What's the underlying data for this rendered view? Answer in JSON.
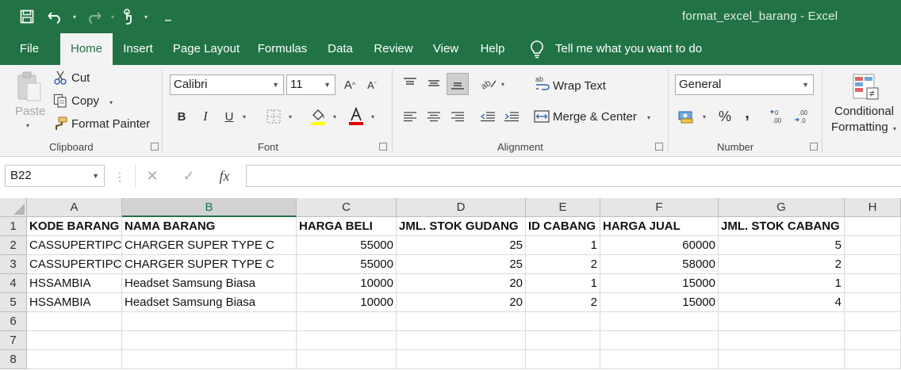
{
  "window": {
    "title": "format_excel_barang  -  Excel"
  },
  "qat": {
    "icons": [
      "save-icon",
      "undo-icon",
      "redo-icon",
      "touch-mode-icon",
      "customize-qat-icon"
    ]
  },
  "tabs": [
    {
      "label": "File"
    },
    {
      "label": "Home"
    },
    {
      "label": "Insert"
    },
    {
      "label": "Page Layout"
    },
    {
      "label": "Formulas"
    },
    {
      "label": "Data"
    },
    {
      "label": "Review"
    },
    {
      "label": "View"
    },
    {
      "label": "Help"
    }
  ],
  "tell_me": "Tell me what you want to do",
  "ribbon": {
    "clipboard": {
      "label": "Clipboard",
      "paste": "Paste",
      "cut": "Cut",
      "copy": "Copy",
      "format_painter": "Format Painter"
    },
    "font": {
      "label": "Font",
      "font_name": "Calibri",
      "font_size": "11",
      "bold": "B",
      "italic": "I",
      "underline": "U",
      "fill_color": "#ffff00",
      "font_color": "#e00000"
    },
    "alignment": {
      "label": "Alignment",
      "wrap_text": "Wrap Text",
      "merge_center": "Merge & Center"
    },
    "number": {
      "label": "Number",
      "format": "General",
      "percent": "%",
      "comma": ","
    },
    "styles": {
      "conditional_formatting_line1": "Conditional",
      "conditional_formatting_line2": "Formatting"
    }
  },
  "formula_bar": {
    "name_box": "B22",
    "fx": "fx",
    "value": ""
  },
  "sheet": {
    "columns": [
      "A",
      "B",
      "C",
      "D",
      "E",
      "F",
      "G",
      "H"
    ],
    "selected_column": "B",
    "rows": [
      [
        "KODE BARANG",
        "NAMA BARANG",
        "HARGA BELI",
        "JML. STOK GUDANG",
        "ID CABANG",
        "HARGA JUAL",
        "JML. STOK CABANG",
        ""
      ],
      [
        "CASSUPERTIPC",
        "CHARGER SUPER TYPE C",
        "55000",
        "25",
        "1",
        "60000",
        "5",
        ""
      ],
      [
        "CASSUPERTIPC",
        "CHARGER SUPER TYPE C",
        "55000",
        "25",
        "2",
        "58000",
        "2",
        ""
      ],
      [
        "HSSAMBIA",
        "Headset Samsung Biasa",
        "10000",
        "20",
        "1",
        "15000",
        "1",
        ""
      ],
      [
        "HSSAMBIA",
        "Headset Samsung Biasa",
        "10000",
        "20",
        "2",
        "15000",
        "4",
        ""
      ],
      [
        "",
        "",
        "",
        "",
        "",
        "",
        "",
        ""
      ],
      [
        "",
        "",
        "",
        "",
        "",
        "",
        "",
        ""
      ],
      [
        "",
        "",
        "",
        "",
        "",
        "",
        "",
        ""
      ]
    ],
    "row_numbers": [
      "1",
      "2",
      "3",
      "4",
      "5",
      "6",
      "7",
      "8"
    ]
  }
}
